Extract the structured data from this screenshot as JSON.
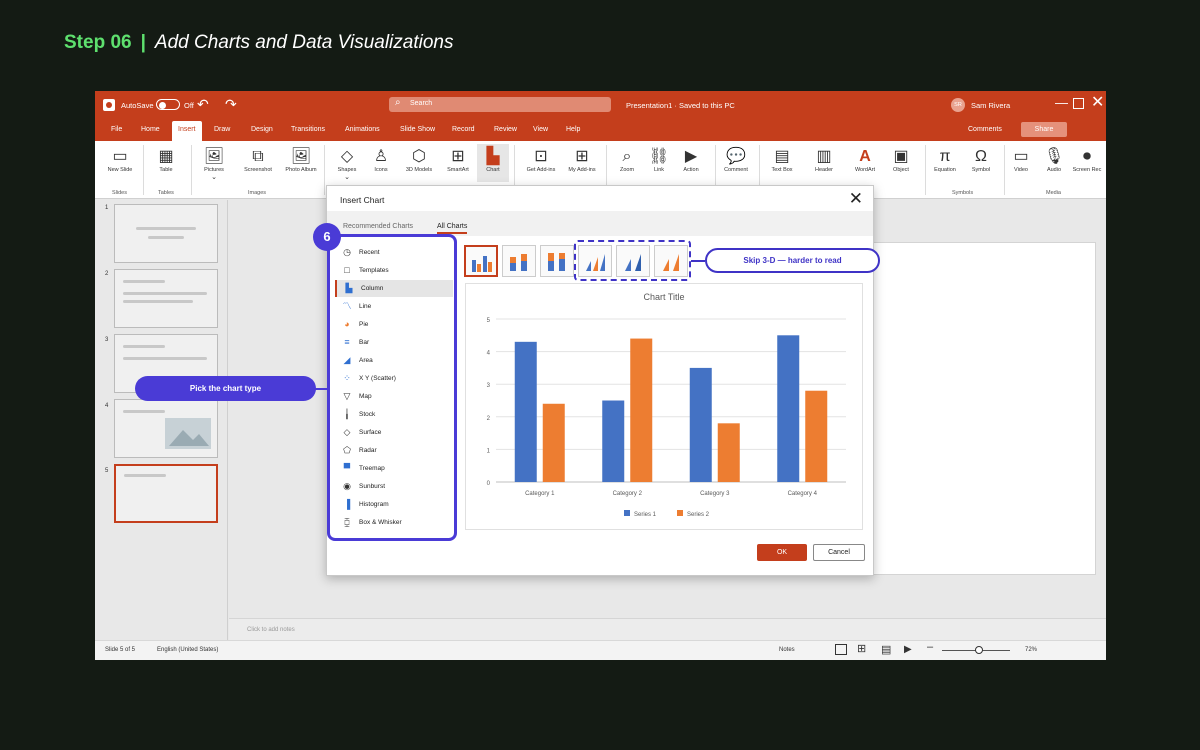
{
  "page": {
    "step_label": "Step 06",
    "separator": "|",
    "heading": "Add Charts and Data Visualizations"
  },
  "titlebar": {
    "autosave_label": "AutoSave",
    "autosave_state": "Off",
    "search_placeholder": "Search",
    "doc_title": "Presentation1 · Saved to this PC",
    "user_initials": "SR",
    "user_name": "Sam Rivera"
  },
  "tabs": [
    "File",
    "Home",
    "Insert",
    "Draw",
    "Design",
    "Transitions",
    "Animations",
    "Slide Show",
    "Record",
    "Review",
    "View",
    "Help"
  ],
  "active_tab": "Insert",
  "tab_actions": {
    "comments": "Comments",
    "share": "Share"
  },
  "ribbon": {
    "buttons": [
      {
        "label": "New Slide",
        "icon": "new-slide-icon"
      },
      {
        "label": "Table",
        "icon": "table-icon"
      },
      {
        "label": "Pictures",
        "icon": "pictures-icon"
      },
      {
        "label": "Screenshot",
        "icon": "screenshot-icon"
      },
      {
        "label": "Photo Album",
        "icon": "photo-album-icon"
      },
      {
        "label": "Shapes",
        "icon": "shapes-icon"
      },
      {
        "label": "Icons",
        "icon": "icons-icon"
      },
      {
        "label": "3D Models",
        "icon": "3d-models-icon"
      },
      {
        "label": "SmartArt",
        "icon": "smartart-icon"
      },
      {
        "label": "Chart",
        "icon": "chart-icon"
      },
      {
        "label": "Get Add-ins",
        "icon": "get-addins-icon"
      },
      {
        "label": "My Add-ins",
        "icon": "my-addins-icon"
      },
      {
        "label": "Zoom",
        "icon": "zoom-icon"
      },
      {
        "label": "Link",
        "icon": "link-icon"
      },
      {
        "label": "Action",
        "icon": "action-icon"
      },
      {
        "label": "Comment",
        "icon": "comment-icon"
      },
      {
        "label": "Text Box",
        "icon": "text-box-icon"
      },
      {
        "label": "Header",
        "icon": "header-icon"
      },
      {
        "label": "WordArt",
        "icon": "wordart-icon"
      },
      {
        "label": "Object",
        "icon": "object-icon"
      },
      {
        "label": "Equation",
        "icon": "equation-icon"
      },
      {
        "label": "Symbol",
        "icon": "symbol-icon"
      },
      {
        "label": "Video",
        "icon": "video-icon"
      },
      {
        "label": "Audio",
        "icon": "audio-icon"
      },
      {
        "label": "Screen Rec",
        "icon": "screen-rec-icon"
      }
    ],
    "groups": [
      "Slides",
      "Tables",
      "Images",
      "Symbols",
      "Media"
    ]
  },
  "slides": {
    "numbers": [
      "1",
      "2",
      "3",
      "4",
      "5"
    ],
    "selected": "5"
  },
  "notes_placeholder": "Click to add notes",
  "status": {
    "slide_info": "Slide 5 of 5",
    "language": "English (United States)",
    "notes": "Notes",
    "zoom": "72%"
  },
  "dialog": {
    "title": "Insert Chart",
    "tabs": [
      "Recommended Charts",
      "All Charts"
    ],
    "active_tab": "All Charts",
    "categories": [
      "Recent",
      "Templates",
      "Column",
      "Line",
      "Pie",
      "Bar",
      "Area",
      "X Y (Scatter)",
      "Map",
      "Stock",
      "Surface",
      "Radar",
      "Treemap",
      "Sunburst",
      "Histogram",
      "Box & Whisker"
    ],
    "selected_category": "Column",
    "ok": "OK",
    "cancel": "Cancel"
  },
  "annotations": {
    "badge": "6",
    "pick_type": "Pick the chart type",
    "skip_3d": "Skip 3-D — harder to read"
  },
  "chart_data": {
    "type": "bar",
    "title": "Chart Title",
    "categories": [
      "Category 1",
      "Category 2",
      "Category 3",
      "Category 4"
    ],
    "series": [
      {
        "name": "Series 1",
        "values": [
          4.3,
          2.5,
          3.5,
          4.5
        ],
        "color": "#4472c4"
      },
      {
        "name": "Series 2",
        "values": [
          2.4,
          4.4,
          1.8,
          2.8
        ],
        "color": "#ed7d31"
      }
    ],
    "ylim": [
      0,
      5
    ],
    "yticks": [
      "0",
      "1",
      "2",
      "3",
      "4",
      "5"
    ],
    "grid": true,
    "legend": "bottom"
  }
}
